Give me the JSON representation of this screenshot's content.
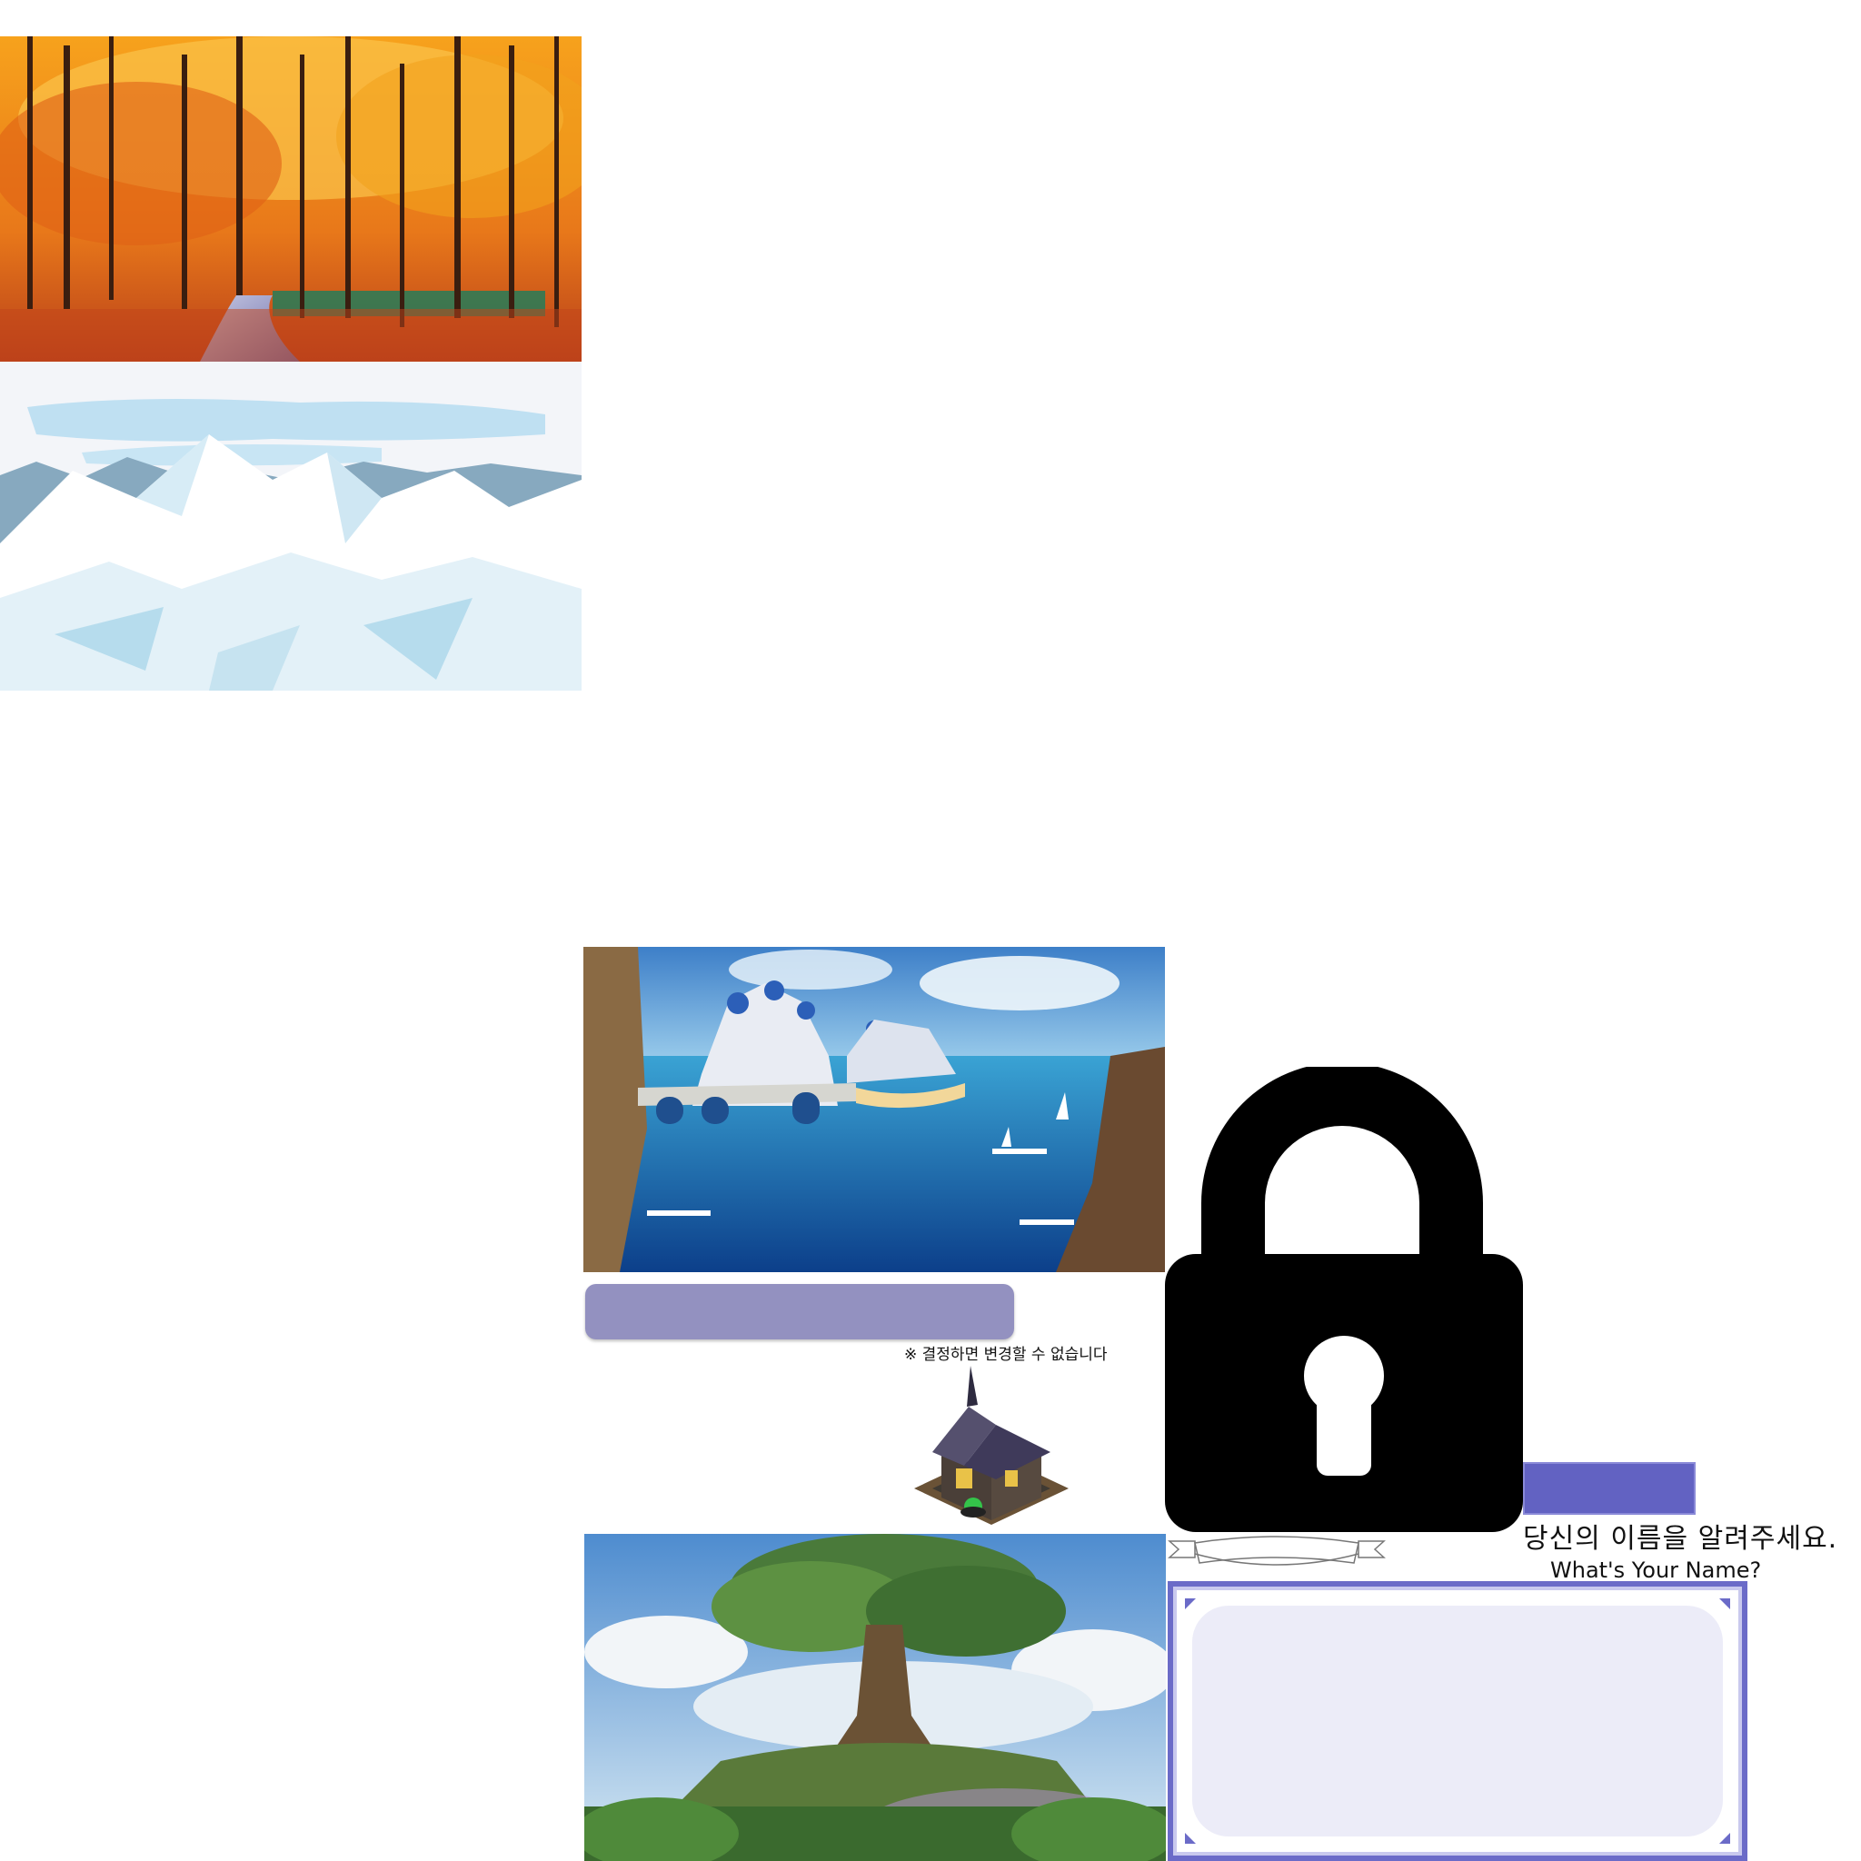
{
  "backgrounds": {
    "autumn": "autumn-forest-painting",
    "snow": "snowy-mountains-illustration",
    "harbor": "fantasy-harbor-town",
    "tree": "world-tree-landscape"
  },
  "icons": {
    "lock": "lock-icon",
    "house": "witch-house-icon",
    "ribbon": "ribbon-banner"
  },
  "notice": {
    "text": "※ 결정하면 변경할 수 없습니다"
  },
  "name_prompt": {
    "title_ko": "당신의 이름을 알려주세요.",
    "title_en": "What's Your Name?",
    "input_value": ""
  },
  "colors": {
    "confirm_bar": "#9391c0",
    "small_button": "#6262c2",
    "frame_border": "#6b6bc8",
    "input_bg": "#ececf8"
  }
}
